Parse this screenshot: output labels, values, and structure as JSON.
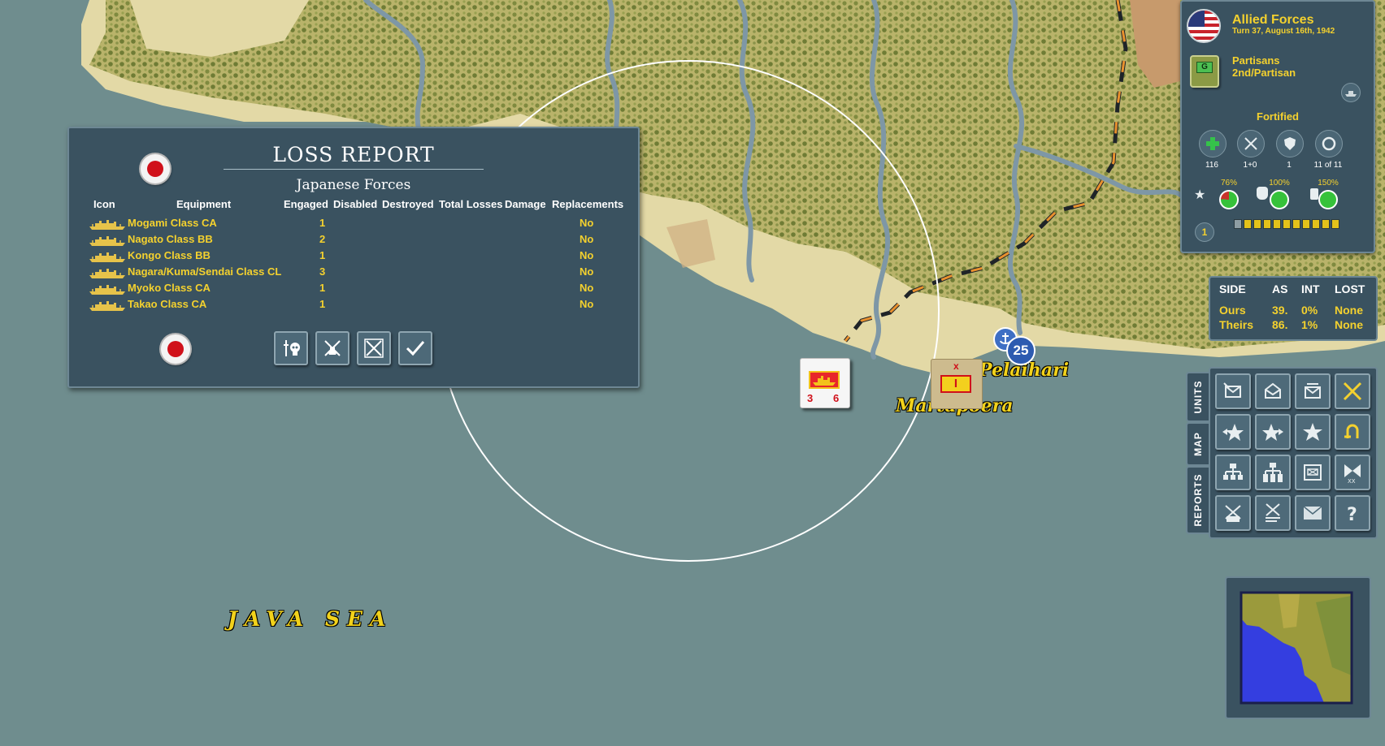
{
  "map": {
    "sea_label": "JAVA SEA",
    "towns": [
      {
        "name": "Pelaihari"
      },
      {
        "name": "Martapoera"
      }
    ],
    "naval_counter": {
      "attack": "3",
      "defense": "6"
    },
    "hq_marker": {
      "label": "25"
    },
    "ground_unit": {
      "size": "x",
      "symbol": "I"
    }
  },
  "loss_report": {
    "title": "LOSS REPORT",
    "side": "Japanese Forces",
    "columns": [
      "Icon",
      "Equipment",
      "Engaged",
      "Disabled",
      "Destroyed",
      "Total Losses",
      "Damage",
      "Replacements"
    ],
    "rows": [
      {
        "name": "Mogami Class CA",
        "engaged": "1",
        "replacements": "No"
      },
      {
        "name": "Nagato Class BB",
        "engaged": "2",
        "replacements": "No"
      },
      {
        "name": "Kongo Class BB",
        "engaged": "1",
        "replacements": "No"
      },
      {
        "name": "Nagara/Kuma/Sendai Class CL",
        "engaged": "3",
        "replacements": "No"
      },
      {
        "name": "Myoko Class CA",
        "engaged": "1",
        "replacements": "No"
      },
      {
        "name": "Takao Class CA",
        "engaged": "1",
        "replacements": "No"
      }
    ],
    "buttons": [
      "casualties-icon",
      "disabled-icon",
      "destroyed-icon",
      "confirm-icon"
    ]
  },
  "unit_panel": {
    "faction": "Allied Forces",
    "turn": "Turn 37, August 16th, 1942",
    "unit_type": "Partisans",
    "unit_name": "2nd/Partisan",
    "unit_badge": "G",
    "status": "Fortified",
    "stats": [
      {
        "icon": "plus-icon",
        "value": "116"
      },
      {
        "icon": "crossed-swords-icon",
        "value": "1+0"
      },
      {
        "icon": "shield-icon",
        "value": "1"
      },
      {
        "icon": "ring-icon",
        "value": "11 of 11"
      }
    ],
    "gauges": [
      {
        "icon": "star-icon",
        "percent_label": "76%",
        "fraction": 0.76
      },
      {
        "icon": "fist-icon",
        "percent_label": "100%",
        "fraction": 1.0
      },
      {
        "icon": "supply-icon",
        "percent_label": "150%",
        "fraction": 1.0
      }
    ],
    "level": "1",
    "steps_filled": 10,
    "steps_total": 11
  },
  "combat": {
    "headers": [
      "SIDE",
      "AS",
      "INT",
      "LOST"
    ],
    "rows": [
      {
        "side": "Ours",
        "as": "39.",
        "int": "0%",
        "lost": "None"
      },
      {
        "side": "Theirs",
        "as": "86.",
        "int": "1%",
        "lost": "None"
      }
    ]
  },
  "tabs": [
    "UNITS",
    "MAP",
    "REPORTS"
  ],
  "command_buttons": [
    "envelope-icon",
    "envelope-open-icon",
    "envelope-queue-icon",
    "crossed-swords-icon",
    "star-left-icon",
    "star-right-icon",
    "star-icon",
    "undo-icon",
    "hierarchy-icon",
    "hierarchy-expand-icon",
    "infantry-list-icon",
    "division-icon",
    "disband-icon",
    "battle-report-icon",
    "mail-icon",
    "help-icon"
  ],
  "colors": {
    "sea": "#6f8d8e",
    "panel": "#3a5260",
    "label_yellow": "#f4d12e",
    "japan_red": "#d0101a"
  }
}
